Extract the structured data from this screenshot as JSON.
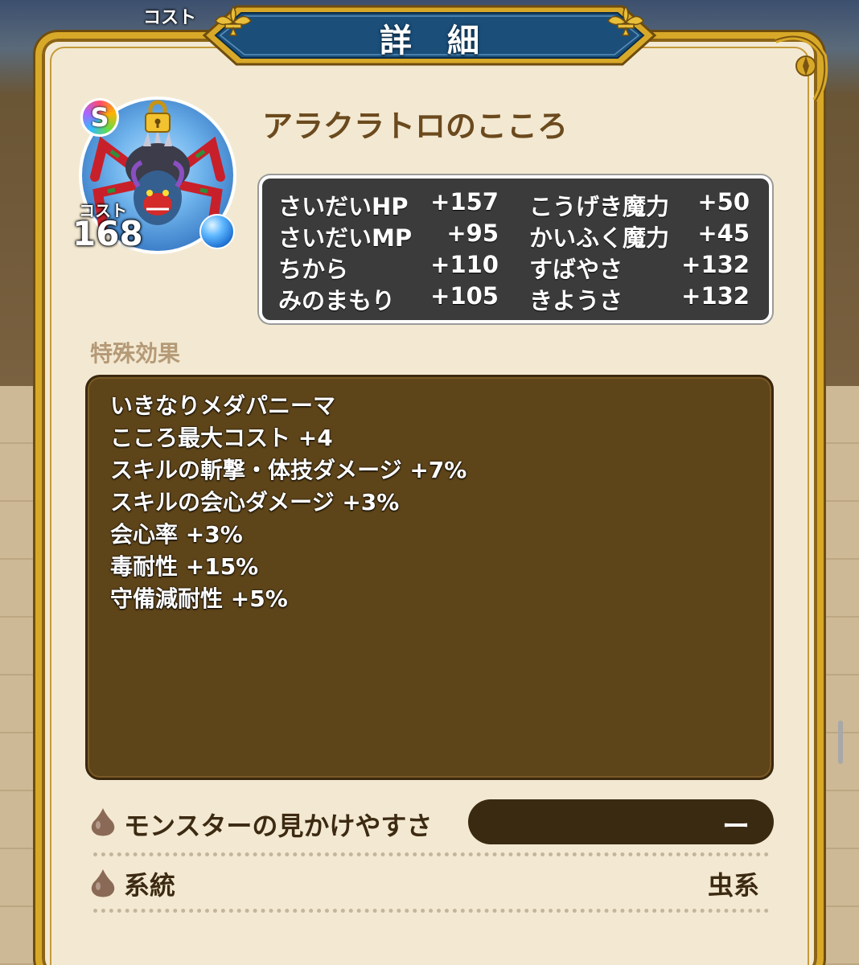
{
  "header": {
    "title": "詳細",
    "behind_cost_label": "コスト"
  },
  "card": {
    "name": "アラクラトロのこころ",
    "rank": "S",
    "cost_label": "コスト",
    "cost_value": "168"
  },
  "stats": [
    {
      "label": "さいだいHP",
      "value": "+157"
    },
    {
      "label": "さいだいMP",
      "value": "+95"
    },
    {
      "label": "ちから",
      "value": "+110"
    },
    {
      "label": "みのまもり",
      "value": "+105"
    },
    {
      "label": "こうげき魔力",
      "value": "+50"
    },
    {
      "label": "かいふく魔力",
      "value": "+45"
    },
    {
      "label": "すばやさ",
      "value": "+132"
    },
    {
      "label": "きようさ",
      "value": "+132"
    }
  ],
  "effects": {
    "section_title": "特殊効果",
    "items": [
      "いきなりメダパニーマ",
      "こころ最大コスト +4",
      "スキルの斬撃・体技ダメージ +7%",
      "スキルの会心ダメージ +3%",
      "会心率 +3%",
      "毒耐性 +15%",
      "守備減耐性 +5%"
    ]
  },
  "visibility": {
    "label": "モンスターの見かけやすさ",
    "value": "ー"
  },
  "family": {
    "label": "系統",
    "value": "虫系"
  },
  "colors": {
    "frame_gold": "#d8a928",
    "panel_bg": "#f3e9d2",
    "stats_bg": "#3b3b3b",
    "effects_bg": "#5e4419",
    "title_banner": "#1b4f7a"
  },
  "icons": {
    "rank": "rainbow-s-badge-icon",
    "lock": "padlock-icon",
    "element": "blue-orb-icon",
    "row_marker": "droplet-icon",
    "fleur": "fleur-de-lis-icon"
  }
}
